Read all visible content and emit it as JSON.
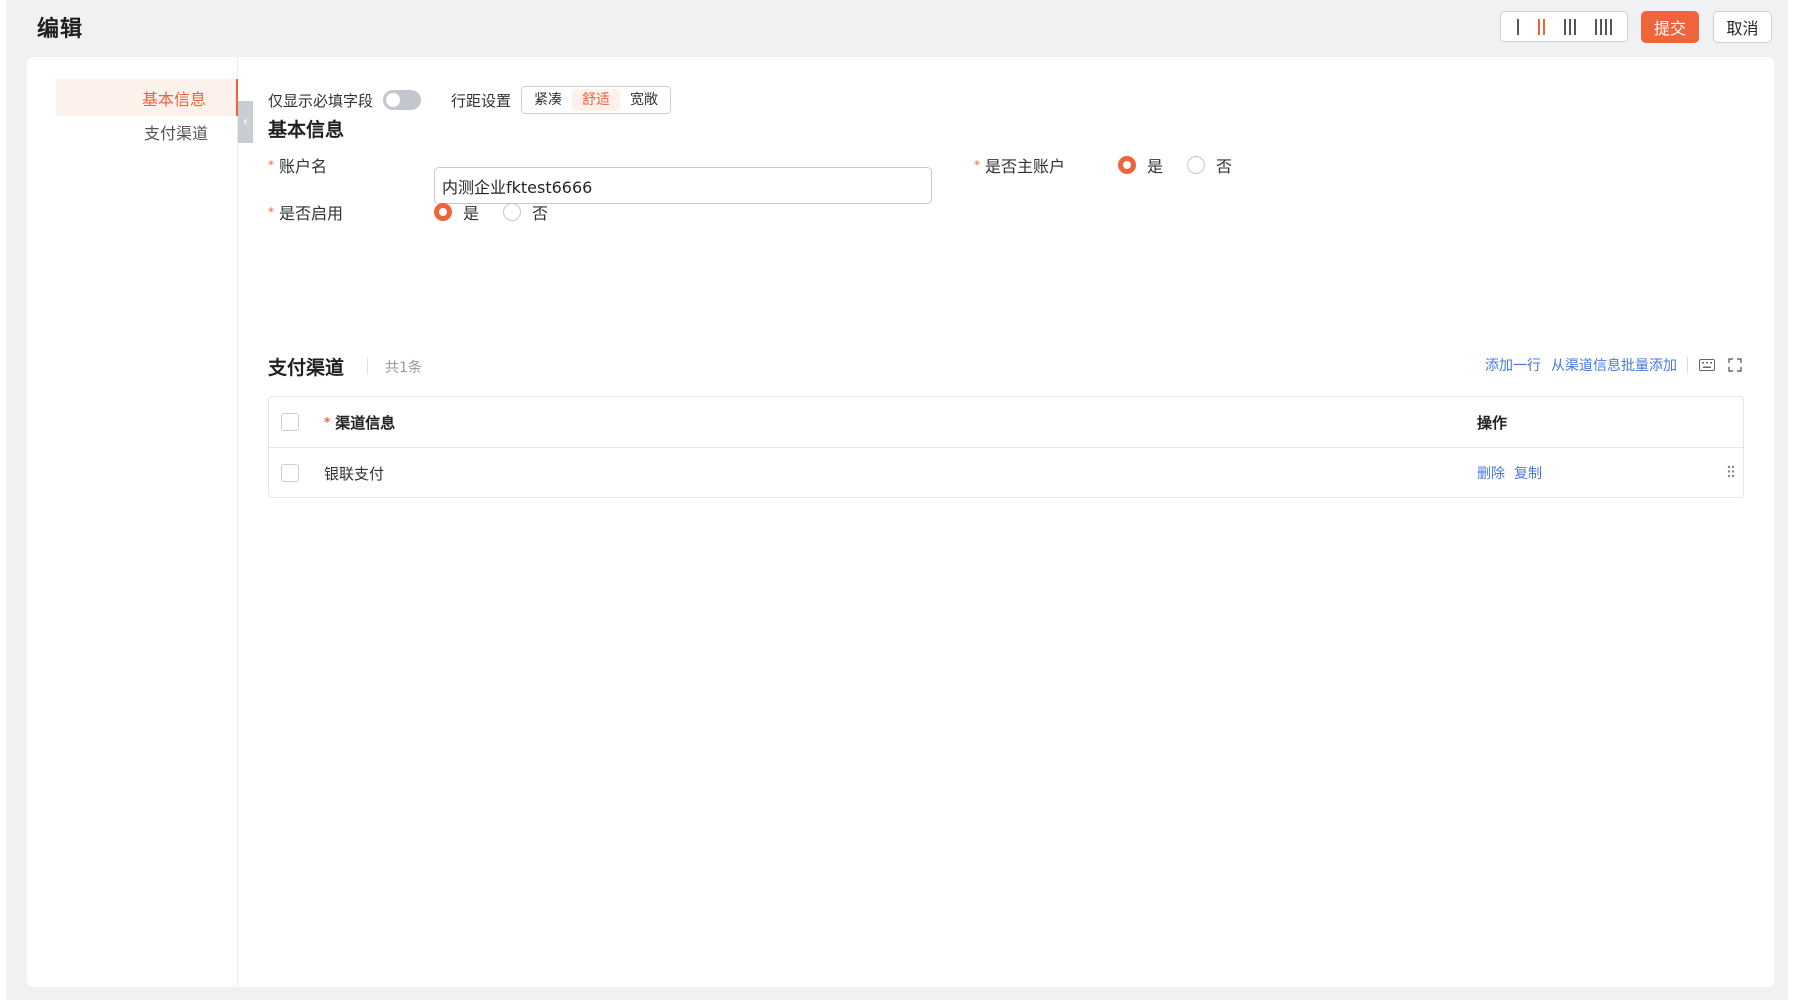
{
  "header": {
    "title": "编辑",
    "submit_label": "提交",
    "cancel_label": "取消",
    "column_options": [
      "1",
      "2",
      "3",
      "4"
    ],
    "column_selected": "2"
  },
  "sidebar": {
    "items": [
      {
        "label": "基本信息",
        "active": true
      },
      {
        "label": "支付渠道",
        "active": false
      }
    ]
  },
  "toolbar": {
    "required_only_label": "仅显示必填字段",
    "required_only_on": false,
    "spacing_label": "行距设置",
    "spacing_options": [
      "紧凑",
      "舒适",
      "宽敞"
    ],
    "spacing_selected": "舒适"
  },
  "basic": {
    "section_title": "基本信息",
    "account_name_label": "账户名",
    "account_name_value": "内测企业fktest6666",
    "is_main_label": "是否主账户",
    "is_main_options": [
      "是",
      "否"
    ],
    "is_main_selected": "是",
    "enabled_label": "是否启用",
    "enabled_options": [
      "是",
      "否"
    ],
    "enabled_selected": "是"
  },
  "payment": {
    "section_title": "支付渠道",
    "count_text": "共1条",
    "add_row_label": "添加一行",
    "batch_add_label": "从渠道信息批量添加",
    "columns": [
      "渠道信息",
      "操作"
    ],
    "rows": [
      {
        "channel": "银联支付",
        "actions": [
          "删除",
          "复制"
        ]
      }
    ]
  },
  "colors": {
    "accent": "#f0643c",
    "link": "#4a78e0",
    "page_bg": "#f0f1f3"
  }
}
